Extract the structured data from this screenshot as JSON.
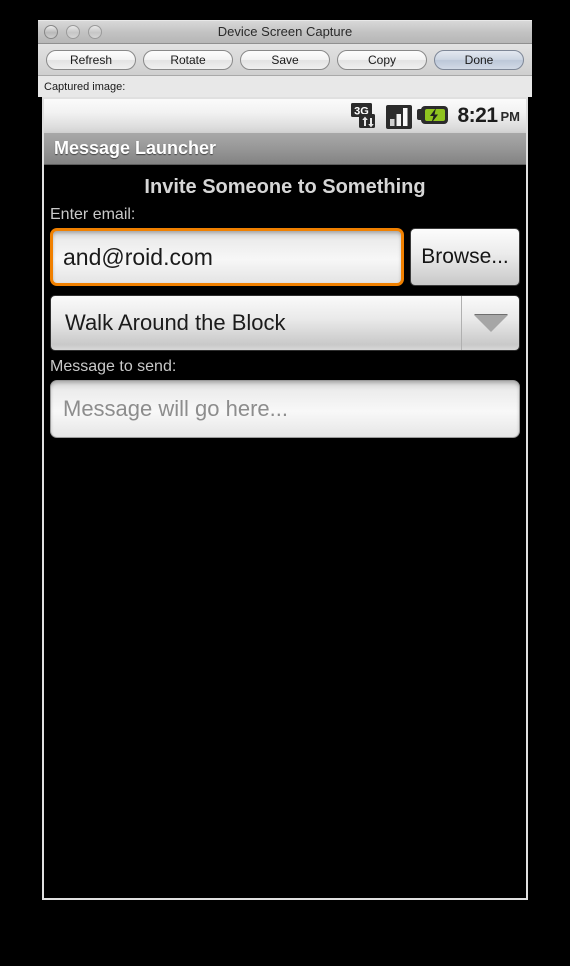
{
  "window": {
    "title": "Device Screen Capture",
    "traffic_lights": [
      "close",
      "minimize",
      "zoom"
    ]
  },
  "toolbar": {
    "buttons": [
      {
        "label": "Refresh",
        "name": "refresh-button",
        "default": false
      },
      {
        "label": "Rotate",
        "name": "rotate-button",
        "default": false
      },
      {
        "label": "Save",
        "name": "save-button",
        "default": false
      },
      {
        "label": "Copy",
        "name": "copy-button",
        "default": false
      },
      {
        "label": "Done",
        "name": "done-button",
        "default": true
      }
    ]
  },
  "captured": {
    "label": "Captured image:"
  },
  "android": {
    "status_bar": {
      "network_icon": "3g-data-icon",
      "network_label": "3G",
      "signal_icon": "signal-bars-icon",
      "battery_icon": "battery-charging-icon",
      "time": "8:21",
      "ampm": "PM"
    },
    "app_title": "Message Launcher",
    "heading": "Invite Someone to Something",
    "email": {
      "label": "Enter email:",
      "value": "and@roid.com",
      "browse_label": "Browse..."
    },
    "activity": {
      "selected": "Walk Around the Block",
      "dropdown_icon": "chevron-down-icon"
    },
    "message": {
      "label": "Message to send:",
      "placeholder": "Message will go here...",
      "value": ""
    }
  },
  "colors": {
    "focus_orange": "#f08000",
    "android_background": "#000000",
    "app_bar_gray": "#999999",
    "battery_green": "#8fc31f"
  }
}
